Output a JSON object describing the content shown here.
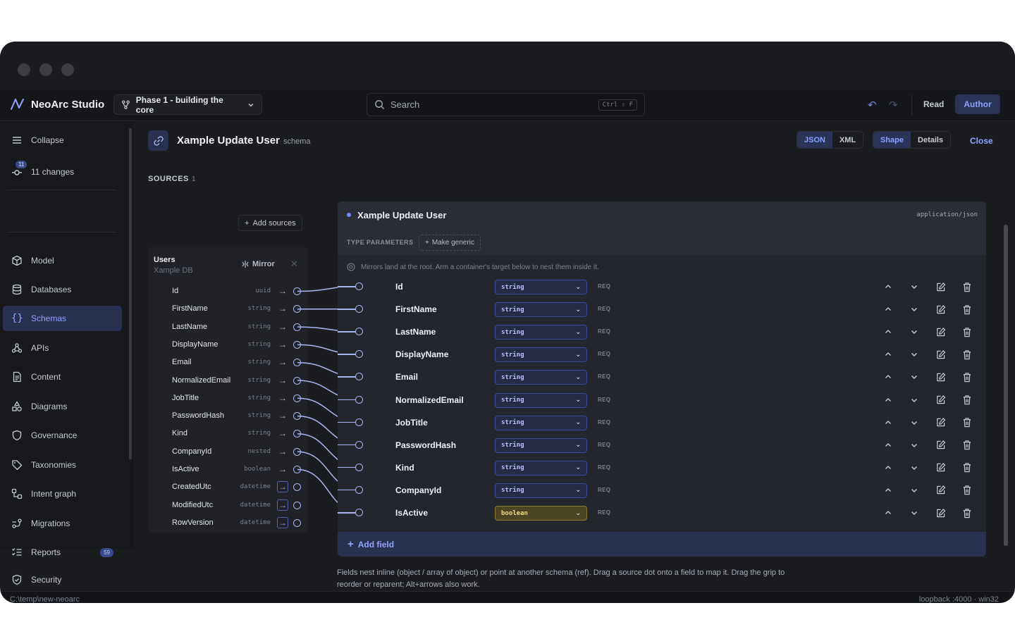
{
  "app": {
    "name": "NeoArc Studio",
    "phase": "Phase 1 - building the core",
    "search_placeholder": "Search",
    "search_shortcut": "Ctrl ⇧ F",
    "modes": [
      "Read",
      "Author"
    ],
    "active_mode": "Author"
  },
  "sidebar": {
    "collapse": "Collapse",
    "changes": "11 changes",
    "changes_badge": "11",
    "items": [
      {
        "label": "Model",
        "icon": "cube-icon"
      },
      {
        "label": "Databases",
        "icon": "database-icon"
      },
      {
        "label": "Schemas",
        "icon": "braces-icon",
        "active": true
      },
      {
        "label": "APIs",
        "icon": "webhook-icon"
      },
      {
        "label": "Content",
        "icon": "document-icon"
      },
      {
        "label": "Diagrams",
        "icon": "shapes-icon"
      },
      {
        "label": "Governance",
        "icon": "shield-icon"
      },
      {
        "label": "Taxonomies",
        "icon": "tag-icon"
      },
      {
        "label": "Intent graph",
        "icon": "graph-icon"
      },
      {
        "label": "Migrations",
        "icon": "migration-icon"
      },
      {
        "label": "Reports",
        "icon": "checklist-icon",
        "badge": "59"
      },
      {
        "label": "Security",
        "icon": "shield-check-icon"
      }
    ]
  },
  "editor": {
    "title": "Xample Update User",
    "subtitle": "schema",
    "format_tabs": [
      "JSON",
      "XML"
    ],
    "active_format": "JSON",
    "view_tabs": [
      "Shape",
      "Details"
    ],
    "active_view": "Shape",
    "close": "Close"
  },
  "sources": {
    "title": "SOURCES",
    "count": "1",
    "add_label": "Add sources",
    "source": {
      "name": "Users",
      "db": "Xample DB",
      "mirror": "Mirror",
      "columns": [
        {
          "name": "Id",
          "type": "uuid",
          "mapped": true
        },
        {
          "name": "FirstName",
          "type": "string",
          "mapped": true
        },
        {
          "name": "LastName",
          "type": "string",
          "mapped": true
        },
        {
          "name": "DisplayName",
          "type": "string",
          "mapped": true
        },
        {
          "name": "Email",
          "type": "string",
          "mapped": true
        },
        {
          "name": "NormalizedEmail",
          "type": "string",
          "mapped": true
        },
        {
          "name": "JobTitle",
          "type": "string",
          "mapped": true
        },
        {
          "name": "PasswordHash",
          "type": "string",
          "mapped": true
        },
        {
          "name": "Kind",
          "type": "string",
          "mapped": true
        },
        {
          "name": "CompanyId",
          "type": "nested",
          "mapped": true
        },
        {
          "name": "IsActive",
          "type": "boolean",
          "mapped": true
        },
        {
          "name": "CreatedUtc",
          "type": "datetime",
          "mapped": false
        },
        {
          "name": "ModifiedUtc",
          "type": "datetime",
          "mapped": false
        },
        {
          "name": "RowVersion",
          "type": "datetime",
          "mapped": false
        }
      ]
    }
  },
  "target": {
    "title": "Xample Update User",
    "mime": "application/json",
    "type_params_label": "TYPE PARAMETERS",
    "make_generic": "Make generic",
    "hint": "Mirrors land at the root. Arm a container's target below to nest them inside it.",
    "req_label": "REQ",
    "fields": [
      {
        "name": "Id",
        "type": "string"
      },
      {
        "name": "FirstName",
        "type": "string"
      },
      {
        "name": "LastName",
        "type": "string"
      },
      {
        "name": "DisplayName",
        "type": "string"
      },
      {
        "name": "Email",
        "type": "string"
      },
      {
        "name": "NormalizedEmail",
        "type": "string"
      },
      {
        "name": "JobTitle",
        "type": "string"
      },
      {
        "name": "PasswordHash",
        "type": "string"
      },
      {
        "name": "Kind",
        "type": "string"
      },
      {
        "name": "CompanyId",
        "type": "string"
      },
      {
        "name": "IsActive",
        "type": "boolean"
      }
    ],
    "add_field": "Add field",
    "footer_hint": "Fields nest inline (object / array of object) or point at another schema (ref). Drag a source dot onto a field to map it. Drag the grip to reorder or reparent; Alt+arrows also work."
  },
  "statusbar": {
    "path": "C:\\temp\\new-neoarc",
    "server": "loopback :4000 · win32"
  },
  "colors": {
    "accent": "#8ea4ff",
    "active_bg": "#2a3150",
    "boolean_badge": "#4a4522"
  }
}
